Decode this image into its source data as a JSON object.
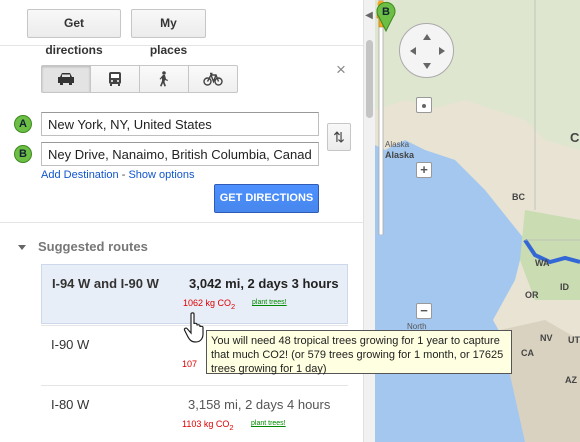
{
  "toolbar": {
    "directions_label": "Get directions",
    "places_label": "My places"
  },
  "modes": [
    {
      "name": "car-icon",
      "active": true
    },
    {
      "name": "transit-icon",
      "active": false
    },
    {
      "name": "walk-icon",
      "active": false
    },
    {
      "name": "bicycle-icon",
      "active": false
    }
  ],
  "close_glyph": "×",
  "origin": {
    "marker": "A",
    "value": "New York, NY, United States"
  },
  "destination": {
    "marker": "B",
    "value": "Ney Drive, Nanaimo, British Columbia, Canada"
  },
  "swap_glyph": "⇅",
  "links": {
    "add_destination": "Add Destination",
    "separator": " - ",
    "show_options": "Show options"
  },
  "get_directions_label": "GET DIRECTIONS",
  "suggested": {
    "heading": "Suggested routes",
    "routes": [
      {
        "name": "I-94 W and I-90 W",
        "distance": "3,042 mi, 2 days 3 hours",
        "co2": "1062 kg CO",
        "co2_sub": "2",
        "trees": "plant trees!",
        "selected": true
      },
      {
        "name": "I-90 W",
        "distance": "",
        "co2": "107",
        "co2_sub": "",
        "trees": "",
        "selected": false
      },
      {
        "name": "I-80 W",
        "distance": "3,158 mi, 2 days 4 hours",
        "co2": "1103 kg CO",
        "co2_sub": "2",
        "trees": "plant trees!",
        "selected": false
      }
    ]
  },
  "tooltip": "You will need 48 tropical trees growing for 1 year to capture that much CO2! (or 579 trees growing for 1 month, or 17625 trees growing for 1 day)",
  "map": {
    "labels": {
      "alaska": "Alaska",
      "alaska_state": "Alaska",
      "bc": "BC",
      "wa": "WA",
      "or": "OR",
      "id": "ID",
      "ca": "CA",
      "nv": "NV",
      "ut": "UT",
      "az": "AZ",
      "c": "C",
      "north": "North"
    },
    "marker": "B",
    "colors": {
      "water": "#a4c7f0",
      "land": "#e8e3d3",
      "green": "#c9dcb2",
      "route": "#3367d6"
    }
  },
  "collapse_glyph": "◀"
}
